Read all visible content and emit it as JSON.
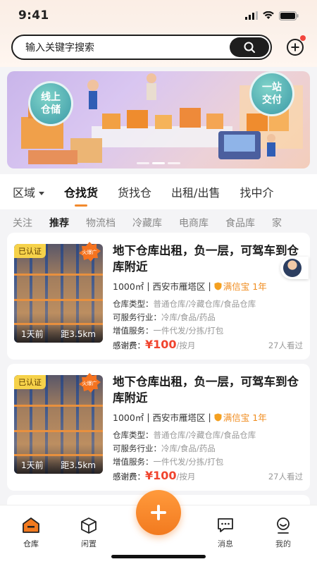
{
  "status": {
    "time": "9:41"
  },
  "search": {
    "placeholder": "输入关键字搜索"
  },
  "banner": {
    "badge_left": "线上\n仓储",
    "badge_right": "一站\n交付"
  },
  "tabs": [
    {
      "label": "区域",
      "has_caret": true
    },
    {
      "label": "仓找货",
      "active": true
    },
    {
      "label": "货找仓"
    },
    {
      "label": "出租/出售"
    },
    {
      "label": "找中介"
    }
  ],
  "sub_tabs": [
    "关注",
    "推荐",
    "物流档",
    "冷藏库",
    "电商库",
    "食品库",
    "家"
  ],
  "listings": [
    {
      "badge": "已认证",
      "hot": "火爆广",
      "time_ago": "1天前",
      "distance": "距3.5km",
      "title": "地下仓库出租，负一层，可驾车到仓库附近",
      "area": "1000㎡",
      "location": "西安市雁塔区",
      "cert": "满信宝",
      "cert_years": "1年",
      "type_key": "仓库类型：",
      "type_val": "普通仓库/冷藏仓库/食品仓库",
      "industry_key": "可服务行业：",
      "industry_val": "冷库/食品/药品",
      "service_key": "增值服务：",
      "service_val": "一件代发/分拣/打包",
      "fee_key": "感谢费：",
      "price": "¥100",
      "price_unit": "/按月",
      "views": "27人看过"
    },
    {
      "badge": "已认证",
      "hot": "火爆广",
      "time_ago": "1天前",
      "distance": "距3.5km",
      "title": "地下仓库出租，负一层，可驾车到仓库附近",
      "area": "1000㎡",
      "location": "西安市雁塔区",
      "cert": "满信宝",
      "cert_years": "1年",
      "type_key": "仓库类型：",
      "type_val": "普通仓库/冷藏仓库/食品仓库",
      "industry_key": "可服务行业：",
      "industry_val": "冷库/食品/药品",
      "service_key": "增值服务：",
      "service_val": "一件代发/分拣/打包",
      "fee_key": "感谢费：",
      "price": "¥100",
      "price_unit": "/按月",
      "views": "27人看过"
    }
  ],
  "nav": {
    "warehouse": "仓库",
    "idle": "闲置",
    "messages": "消息",
    "mine": "我的"
  },
  "colors": {
    "accent": "#f27a1f",
    "price": "#f0442e"
  }
}
